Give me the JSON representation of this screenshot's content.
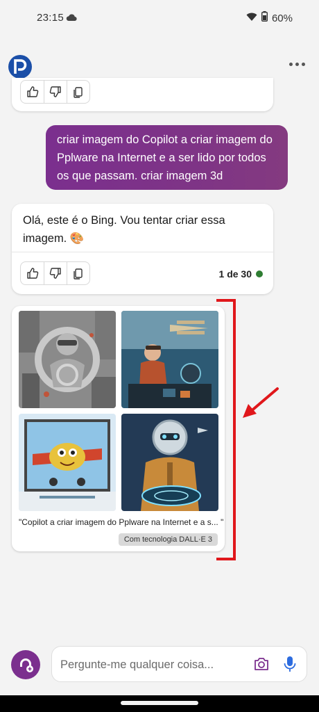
{
  "status_bar": {
    "time": "23:15",
    "battery": "60%",
    "icons": [
      "cloud-icon",
      "wifi-icon",
      "battery-icon"
    ]
  },
  "header": {
    "logo_icon": "pplware-logo",
    "menu_icon": "more-vert-icon"
  },
  "user_message": {
    "text": "criar imagem do Copilot a criar imagem do Pplware na Internet e a ser lido por todos os que passam. criar imagem 3d"
  },
  "bot_message": {
    "text": "Olá, este é o Bing. Vou tentar criar essa imagem. 🎨",
    "counter": "1 de 30",
    "counter_status_color": "#2e7d32"
  },
  "image_result": {
    "caption": "\"Copilot a criar imagem do Pplware na Internet e a s... \"",
    "badge": "Com tecnologia DALL·E 3",
    "images": [
      "city-pilot-sculpture",
      "pilot-biplane-cockpit",
      "cartoon-airplane-screen",
      "robot-pilot-tablet"
    ]
  },
  "composer": {
    "placeholder": "Pergunte-me qualquer coisa...",
    "accent_color": "#7b2f8e",
    "mic_color": "#2d6cdf"
  },
  "annotation": {
    "color": "#e0171b"
  }
}
